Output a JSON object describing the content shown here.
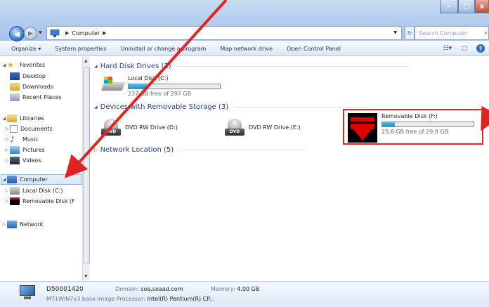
{
  "window": {
    "controls": {
      "minimize": "–",
      "maximize": "□",
      "close": "x"
    }
  },
  "address": {
    "path": [
      "Computer"
    ],
    "search_placeholder": "Search Computer"
  },
  "toolbar": {
    "organize": "Organize ▾",
    "system_properties": "System properties",
    "uninstall": "Uninstall or change a program",
    "map_drive": "Map network drive",
    "control_panel": "Open Control Panel"
  },
  "nav": {
    "favorites": "Favorites",
    "desktop": "Desktop",
    "downloads": "Downloads",
    "recent": "Recent Places",
    "libraries": "Libraries",
    "documents": "Documents",
    "music": "Music",
    "pictures": "Pictures",
    "videos": "Videos",
    "computer": "Computer",
    "local_disk": "Local Disk (C:)",
    "removable": "Removable Disk (F",
    "network": "Network"
  },
  "groups": {
    "hdd": "Hard Disk Drives (1)",
    "removable": "Devices with Removable Storage (3)",
    "network": "Network Location (5)"
  },
  "drives": {
    "c": {
      "name": "Local Disk (C:)",
      "free": "237 GB free of 297 GB",
      "used_fraction": 0.2
    },
    "d": {
      "name": "DVD RW Drive (D:)"
    },
    "e": {
      "name": "DVD RW Drive (E:)"
    },
    "f": {
      "name": "Removable Disk (F:)",
      "free": "25.6 GB free of 29.8 GB",
      "used_fraction": 0.14
    }
  },
  "dvd_label": "DVD",
  "details": {
    "name": "D50001420",
    "domain_label": "Domain:",
    "domain": "soa.soaad.com",
    "memory_label": "Memory:",
    "memory": "4.00 GB",
    "desc": "M71WIN7v3 base image",
    "processor_label": "Processor:",
    "processor": "Intel(R) Pentium(R) CP..."
  },
  "colors": {
    "annotation_red": "#e02424",
    "group_header": "#1e3f8f"
  }
}
